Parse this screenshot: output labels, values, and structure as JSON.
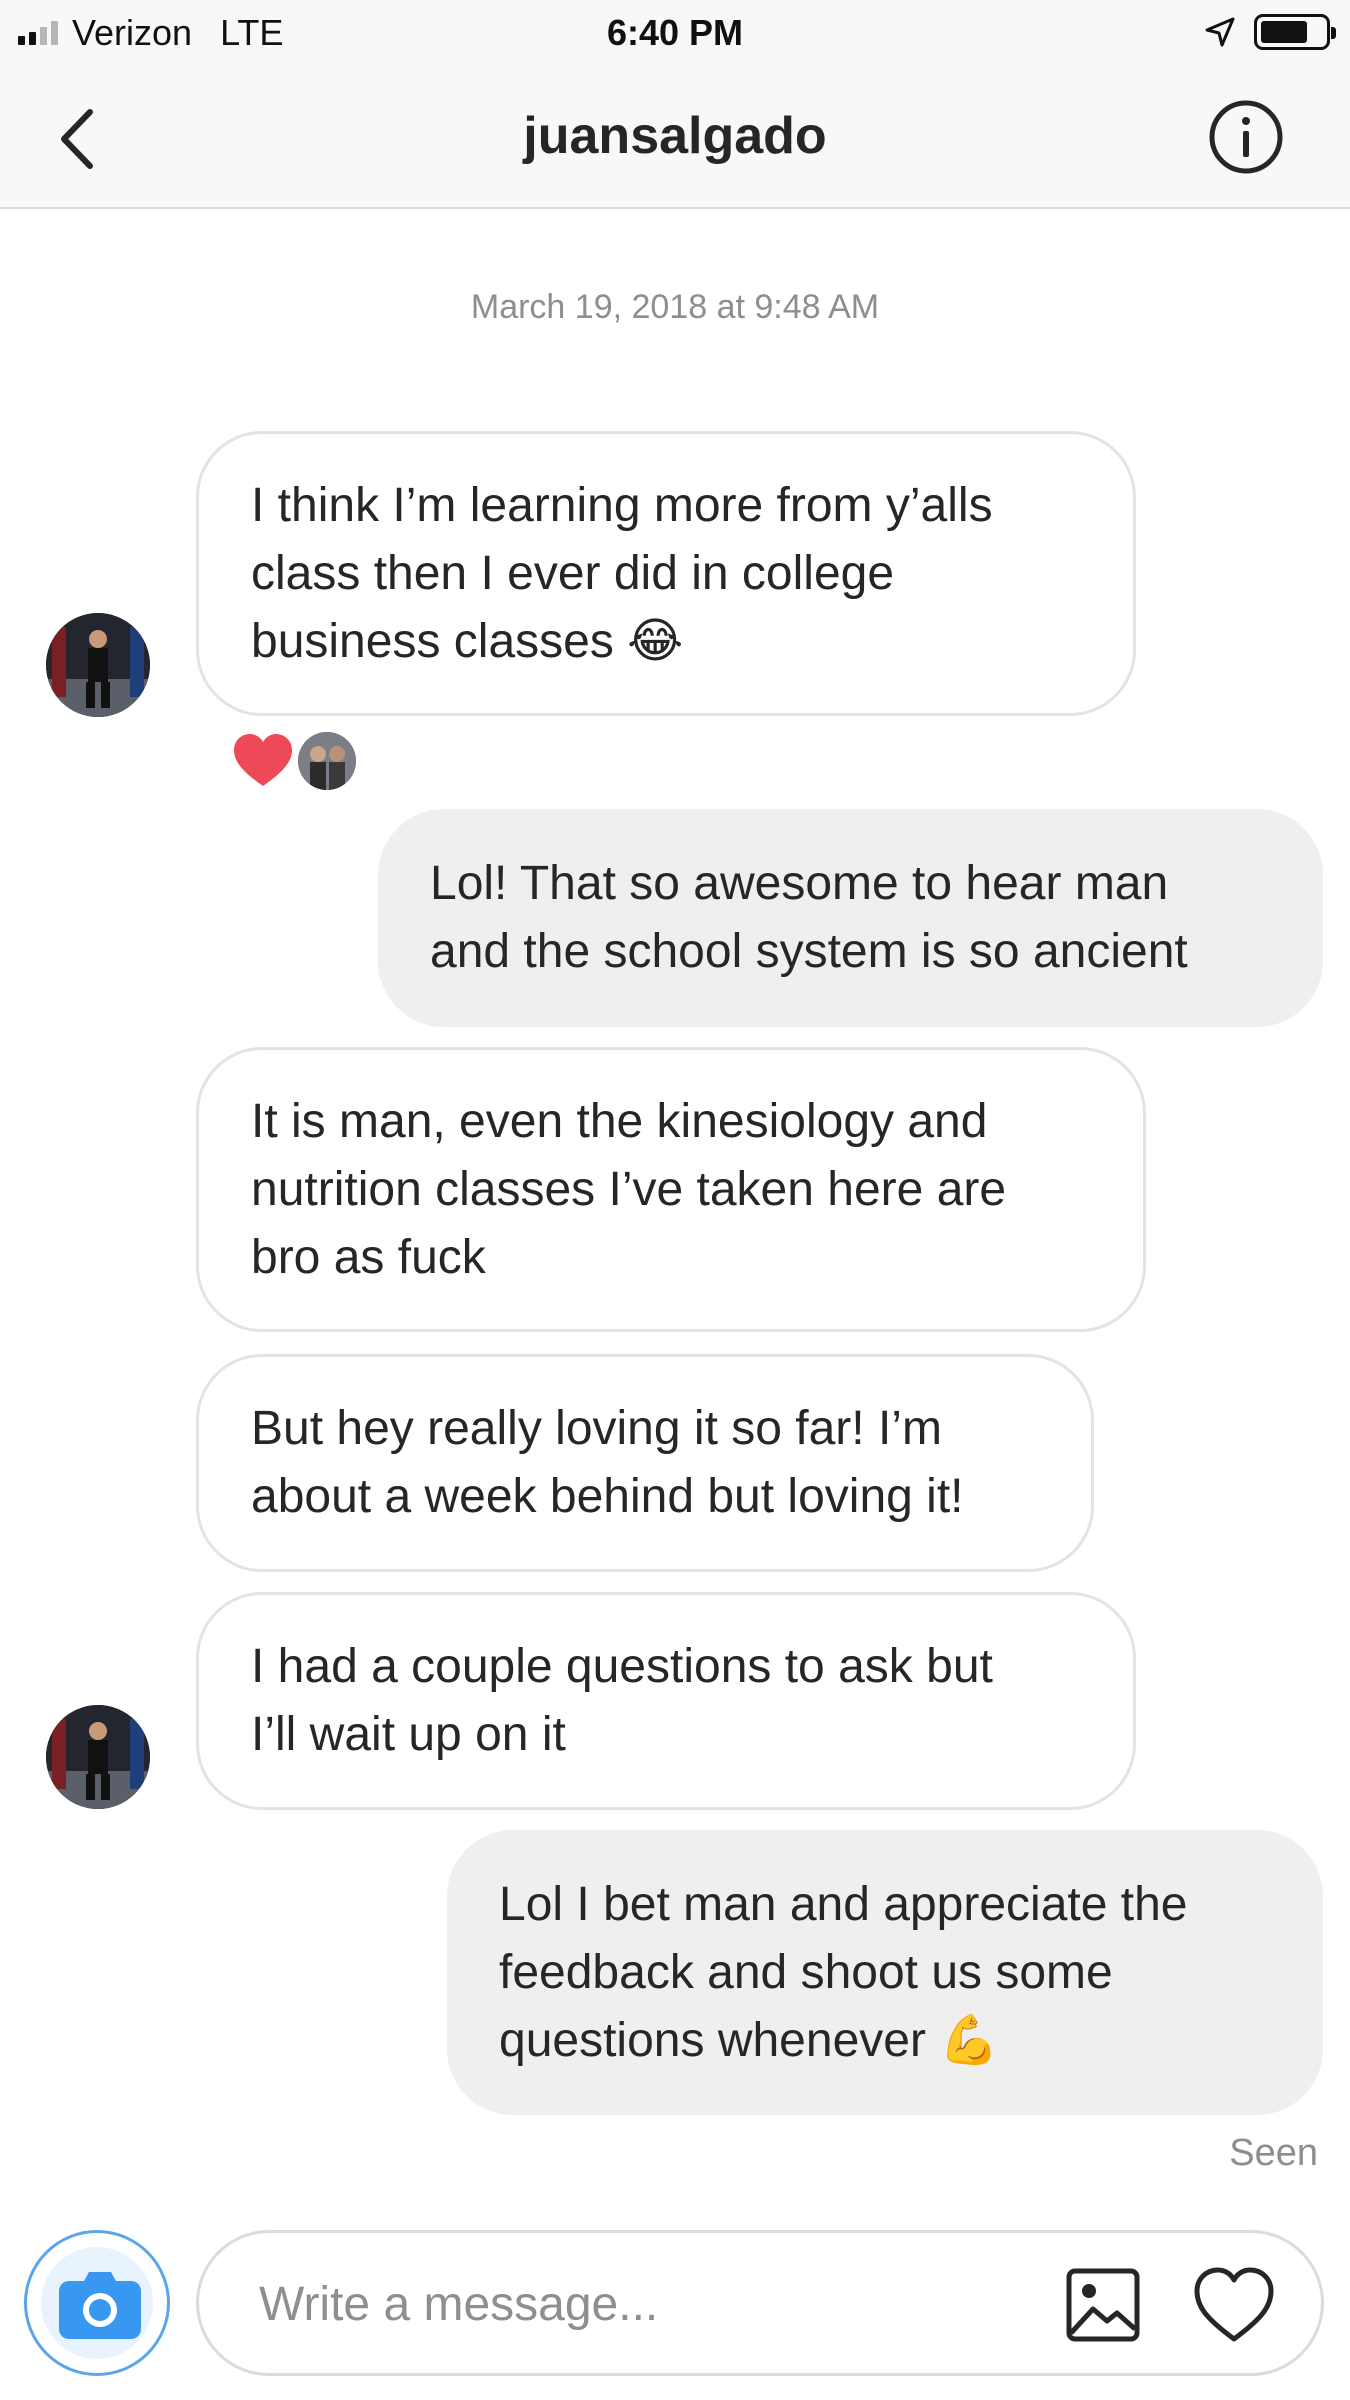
{
  "status_bar": {
    "carrier": "Verizon",
    "network": "LTE",
    "time": "6:40 PM"
  },
  "header": {
    "title": "juansalgado",
    "back_icon": "chevron-left-icon",
    "info_icon": "info-circle-icon"
  },
  "thread": {
    "timestamp": "March 19, 2018 at 9:48 AM",
    "messages": [
      {
        "direction": "incoming",
        "text": "I think I’m learning more from y’alls\nclass then I ever did in college\nbusiness classes 😂"
      },
      {
        "direction": "outgoing",
        "text": "Lol! That so awesome to hear man\nand the school system is so ancient"
      },
      {
        "direction": "incoming",
        "text": "It is man, even the kinesiology and\nnutrition classes I’ve taken here are\nbro as fuck"
      },
      {
        "direction": "incoming",
        "text": "But hey really loving it so far! I’m\nabout a week behind but loving it!"
      },
      {
        "direction": "incoming",
        "text": "I had a couple questions to ask but\nI’ll wait up on it"
      },
      {
        "direction": "outgoing",
        "text": "Lol I bet man and appreciate the\nfeedback and shoot us some\nquestions whenever 💪"
      }
    ],
    "reaction": "heart-icon",
    "seen_label": "Seen"
  },
  "composer": {
    "placeholder": "Write a message...",
    "camera_icon": "camera-icon",
    "gallery_icon": "image-gallery-icon",
    "like_icon": "heart-outline-icon"
  },
  "colors": {
    "incoming_border": "#e3e3e3",
    "outgoing_bg": "#efefef",
    "camera_blue": "#3897f0",
    "reaction_red": "#ed4956",
    "muted_text": "#8e8e8e"
  }
}
